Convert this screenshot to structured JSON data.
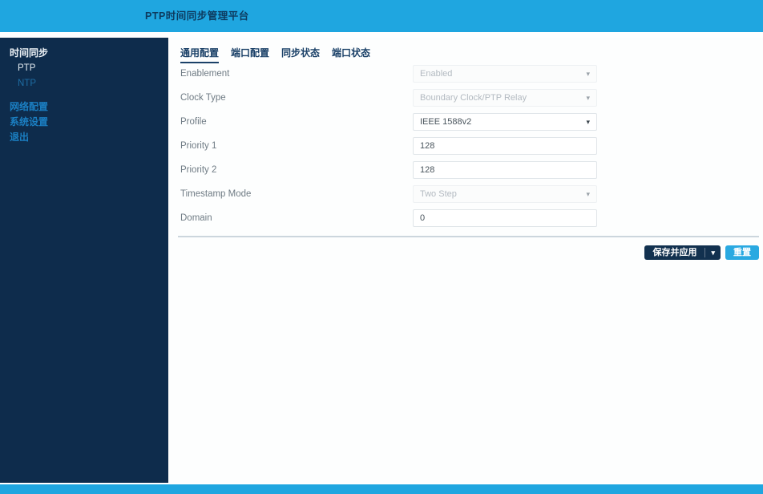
{
  "header": {
    "title": "PTP时间同步管理平台"
  },
  "sidebar": {
    "items": [
      {
        "label": "时间同步"
      },
      {
        "label": "PTP"
      },
      {
        "label": "NTP"
      },
      {
        "label": "网络配置"
      },
      {
        "label": "系统设置"
      },
      {
        "label": "退出"
      }
    ]
  },
  "tabs": [
    {
      "label": "通用配置",
      "active": true
    },
    {
      "label": "端口配置",
      "active": false
    },
    {
      "label": "同步状态",
      "active": false
    },
    {
      "label": "端口状态",
      "active": false
    }
  ],
  "form": {
    "fields": [
      {
        "label": "Enablement",
        "value": "Enabled",
        "control": "select",
        "state": "disabled"
      },
      {
        "label": "Clock Type",
        "value": "Boundary Clock/PTP Relay",
        "control": "select",
        "state": "disabled"
      },
      {
        "label": "Profile",
        "value": "IEEE 1588v2",
        "control": "select",
        "state": "enabled"
      },
      {
        "label": "Priority 1",
        "value": "128",
        "control": "input",
        "state": "enabled"
      },
      {
        "label": "Priority 2",
        "value": "128",
        "control": "input",
        "state": "enabled"
      },
      {
        "label": "Timestamp Mode",
        "value": "Two Step",
        "control": "select",
        "state": "disabled"
      },
      {
        "label": "Domain",
        "value": "0",
        "control": "input",
        "state": "enabled"
      }
    ]
  },
  "actions": {
    "save_apply_label": "保存并应用",
    "reset_label": "重置"
  },
  "icons": {
    "chevron_down": "▾"
  },
  "colors": {
    "accent_cyan": "#1fa6e0",
    "navy": "#0e2c4c",
    "link_blue": "#1b7fc2",
    "tab_navy": "#1b4168"
  }
}
